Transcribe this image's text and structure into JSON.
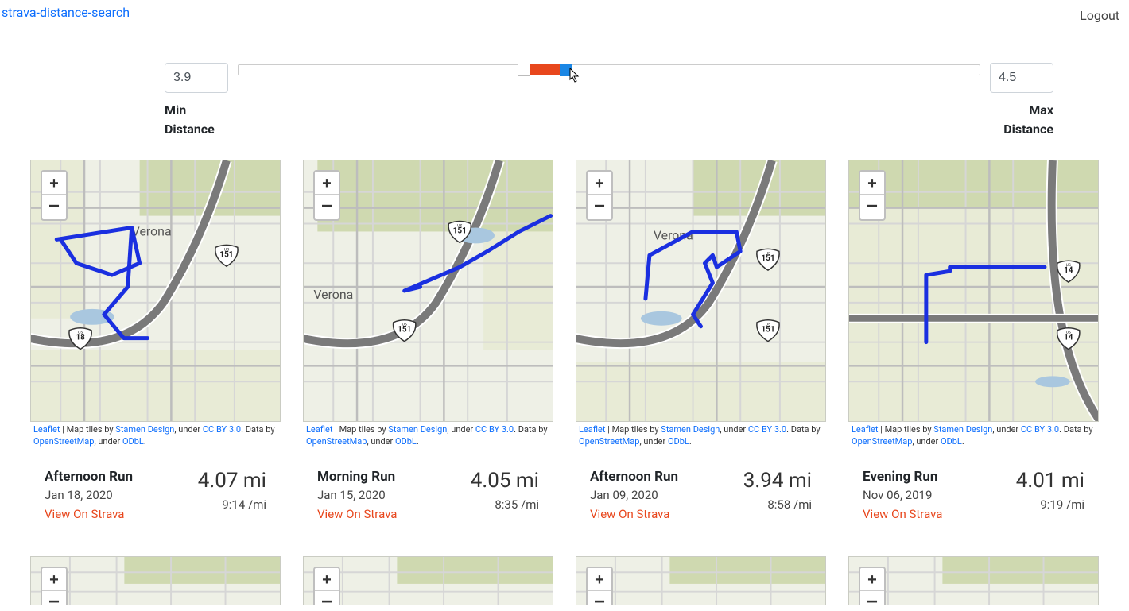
{
  "topbar": {
    "brand": "strava-distance-search",
    "logout": "Logout"
  },
  "slider": {
    "min_value": "3.9",
    "max_value": "4.5",
    "min_label_1": "Min",
    "min_label_2": "Distance",
    "max_label_1": "Max",
    "max_label_2": "Distance",
    "range_min": 0,
    "range_max": 10,
    "fill_left_pct": 38.2,
    "fill_width_pct": 6.2,
    "handle_min_pct": 37.7,
    "handle_max_pct": 43.4
  },
  "attribution": {
    "leaflet": "Leaflet",
    "sep": " | Map tiles by ",
    "stamen": "Stamen Design",
    "under1": ", under ",
    "cc": "CC BY 3.0",
    "data_by": ". Data by ",
    "osm": "OpenStreetMap",
    "under2": ", under ",
    "odbl": "ODbL",
    "dot": "."
  },
  "view_label": "View On Strava",
  "activities": [
    {
      "title": "Afternoon Run",
      "date": "Jan 18, 2020",
      "distance": "4.07 mi",
      "pace": "9:14 /mi",
      "town": "Verona",
      "hwy": [
        "18",
        "151"
      ],
      "route_variant": "loop-left"
    },
    {
      "title": "Morning Run",
      "date": "Jan 15, 2020",
      "distance": "4.05 mi",
      "pace": "8:35 /mi",
      "town": "Verona",
      "hwy": [
        "151",
        "151"
      ],
      "route_variant": "diag"
    },
    {
      "title": "Afternoon Run",
      "date": "Jan 09, 2020",
      "distance": "3.94 mi",
      "pace": "8:58 /mi",
      "town": "Verona",
      "hwy": [
        "151",
        "151"
      ],
      "route_variant": "loop-wedge"
    },
    {
      "title": "Evening Run",
      "date": "Nov 06, 2019",
      "distance": "4.01 mi",
      "pace": "9:19 /mi",
      "town": "",
      "hwy": [
        "14",
        "14"
      ],
      "route_variant": "ell"
    }
  ]
}
